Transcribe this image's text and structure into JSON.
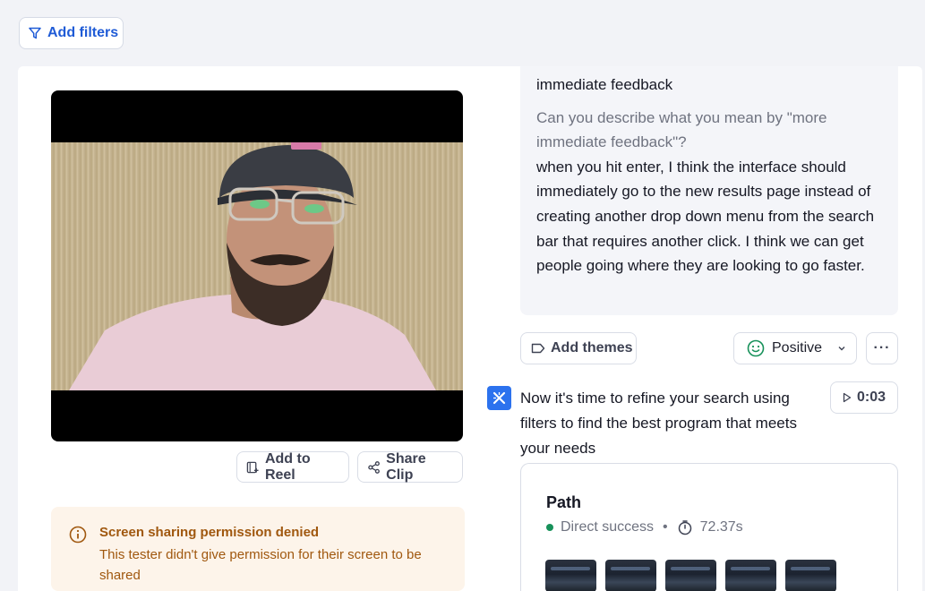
{
  "filters": {
    "add_label": "Add filters"
  },
  "video": {
    "add_to_reel_label": "Add to Reel",
    "share_clip_label": "Share Clip"
  },
  "warning": {
    "title": "Screen sharing permission denied",
    "body": "This tester didn't give permission for their screen to be shared",
    "color": "#a0580f"
  },
  "response": {
    "previous_tail": "immediate feedback",
    "question": "Can you describe what you mean by \"more immediate feedback\"?",
    "answer": "when you hit enter, I think the interface should immediately go to the new results page instead of creating another drop down menu from the search bar that requires another click. I think we can get people going where they are looking to go faster."
  },
  "actions": {
    "add_themes_label": "Add themes",
    "sentiment_label": "Positive",
    "more_label": "···"
  },
  "task": {
    "text": "Now it's time to refine your search using filters to find the best program that meets your needs",
    "timestamp": "0:03",
    "icon": "task-cross-icon",
    "accent": "#2c72ee"
  },
  "path": {
    "title": "Path",
    "status": "Direct success",
    "separator": "•",
    "duration": "72.37s",
    "status_color": "#17915a"
  }
}
